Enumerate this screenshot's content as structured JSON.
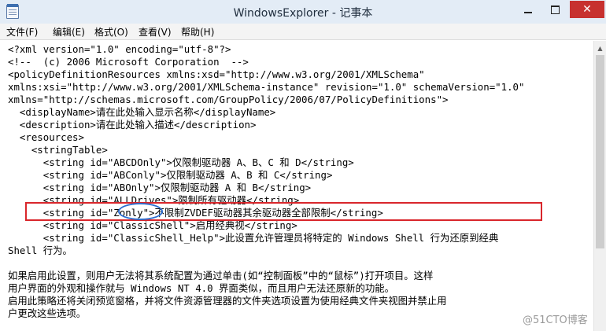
{
  "window": {
    "title": "WindowsExplorer - 记事本",
    "close_glyph": "✕",
    "icons": {
      "app": "notepad-icon",
      "minimize": "minimize-icon",
      "maximize": "maximize-icon",
      "close": "close-icon"
    }
  },
  "menu": [
    {
      "label": "文件(F)"
    },
    {
      "label": "编辑(E)"
    },
    {
      "label": "格式(O)"
    },
    {
      "label": "查看(V)"
    },
    {
      "label": "帮助(H)"
    }
  ],
  "document": {
    "lines": [
      "<?xml version=\"1.0\" encoding=\"utf-8\"?>",
      "<!--  (c) 2006 Microsoft Corporation  -->",
      "<policyDefinitionResources xmlns:xsd=\"http://www.w3.org/2001/XMLSchema\"",
      "xmlns:xsi=\"http://www.w3.org/2001/XMLSchema-instance\" revision=\"1.0\" schemaVersion=\"1.0\"",
      "xmlns=\"http://schemas.microsoft.com/GroupPolicy/2006/07/PolicyDefinitions\">",
      "  <displayName>请在此处输入显示名称</displayName>",
      "  <description>请在此处输入描述</description>",
      "  <resources>",
      "    <stringTable>",
      "      <string id=\"ABCDOnly\">仅限制驱动器 A、B、C 和 D</string>",
      "      <string id=\"ABConly\">仅限制驱动器 A、B 和 C</string>",
      "      <string id=\"ABOnly\">仅限制驱动器 A 和 B</string>",
      "      <string id=\"ALLDrives\">限制所有驱动器</string>",
      "      <string id=\"Zonly\">不限制ZVDEF驱动器其余驱动器全部限制</string>",
      "      <string id=\"ClassicShell\">启用经典视</string>",
      "      <string id=\"ClassicShell_Help\">此设置允许管理员将特定的 Windows Shell 行为还原到经典",
      "Shell 行为。",
      "",
      "如果启用此设置，则用户无法将其系统配置为通过单击(如“控制面板”中的“鼠标”)打开项目。这样",
      "用户界面的外观和操作就与 Windows NT 4.0 界面类似，而且用户无法还原新的功能。",
      "启用此策略还将关闭预览窗格，并将文件资源管理器的文件夹选项设置为使用经典文件夹视图并禁止用",
      "户更改这些选项。"
    ]
  },
  "watermark": "@51CTO博客"
}
